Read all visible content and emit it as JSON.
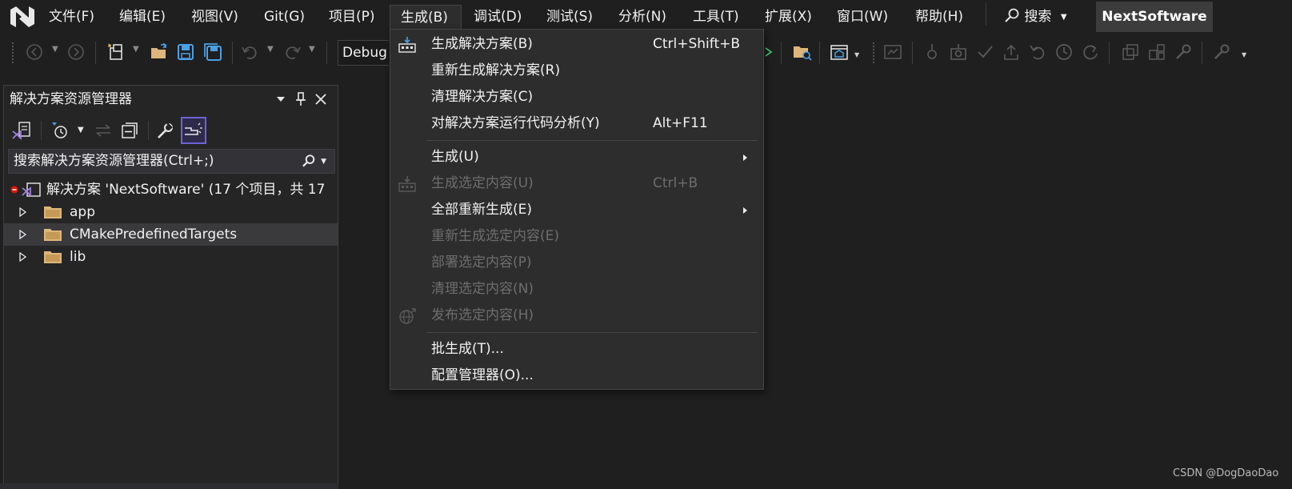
{
  "menubar": {
    "items": [
      {
        "label": "文件(F)"
      },
      {
        "label": "编辑(E)"
      },
      {
        "label": "视图(V)"
      },
      {
        "label": "Git(G)"
      },
      {
        "label": "项目(P)"
      },
      {
        "label": "生成(B)"
      },
      {
        "label": "调试(D)"
      },
      {
        "label": "测试(S)"
      },
      {
        "label": "分析(N)"
      },
      {
        "label": "工具(T)"
      },
      {
        "label": "扩展(X)"
      },
      {
        "label": "窗口(W)"
      },
      {
        "label": "帮助(H)"
      }
    ],
    "open_menu": "生成(B)",
    "search_label": "搜索",
    "solution_name": "NextSoftware"
  },
  "toolbar": {
    "configuration": "Debug"
  },
  "build_menu": {
    "items": [
      {
        "label": "生成解决方案(B)",
        "shortcut": "Ctrl+Shift+B",
        "enabled": true,
        "icon": "build-solution-icon"
      },
      {
        "label": "重新生成解决方案(R)",
        "shortcut": "",
        "enabled": true
      },
      {
        "label": "清理解决方案(C)",
        "shortcut": "",
        "enabled": true
      },
      {
        "label": "对解决方案运行代码分析(Y)",
        "shortcut": "Alt+F11",
        "enabled": true
      },
      {
        "label": "生成(U)",
        "shortcut": "",
        "enabled": true,
        "submenu": true
      },
      {
        "label": "生成选定内容(U)",
        "shortcut": "Ctrl+B",
        "enabled": false,
        "icon": "build-selection-icon"
      },
      {
        "label": "全部重新生成(E)",
        "shortcut": "",
        "enabled": true,
        "submenu": true
      },
      {
        "label": "重新生成选定内容(E)",
        "shortcut": "",
        "enabled": false
      },
      {
        "label": "部署选定内容(P)",
        "shortcut": "",
        "enabled": false
      },
      {
        "label": "清理选定内容(N)",
        "shortcut": "",
        "enabled": false
      },
      {
        "label": "发布选定内容(H)",
        "shortcut": "",
        "enabled": false,
        "icon": "publish-globe-icon"
      },
      {
        "label": "批生成(T)...",
        "shortcut": "",
        "enabled": true
      },
      {
        "label": "配置管理器(O)...",
        "shortcut": "",
        "enabled": true
      }
    ]
  },
  "solution_explorer": {
    "title": "解决方案资源管理器",
    "search_placeholder": "搜索解决方案资源管理器(Ctrl+;)",
    "root_label": "解决方案 'NextSoftware' (17 个项目，共 17",
    "folders": [
      {
        "label": "app"
      },
      {
        "label": "CMakePredefinedTargets"
      },
      {
        "label": "lib"
      }
    ]
  },
  "watermark": "CSDN @DogDaoDao",
  "colors": {
    "background": "#1f1f1f",
    "menu_background": "#2d2d2d",
    "accent": "#6d63d6",
    "folder": "#dcb67a",
    "disabled_text": "#6d6d6d"
  }
}
